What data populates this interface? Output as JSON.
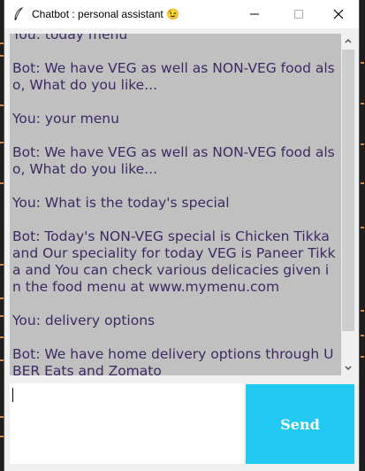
{
  "window": {
    "title": "Chatbot : personal assistant 😉"
  },
  "chat": {
    "messages": [
      "You: today menu",
      "Bot: We have VEG as well as NON-VEG food also, What do you like...",
      "You: your menu",
      "Bot: We have VEG as well as NON-VEG food also, What do you like...",
      "You: What is the today's special",
      "Bot: Today's NON-VEG special is Chicken Tikka and Our speciality for today VEG is Paneer Tikka and You can check various delicacies given in the food menu at www.mymenu.com",
      "You: delivery options",
      "Bot: We have home delivery options through UBER Eats and Zomato"
    ]
  },
  "input": {
    "value": ""
  },
  "send": {
    "label": "Send"
  },
  "colors": {
    "chat_bg": "#c0c0c0",
    "chat_text": "#3d2a63",
    "send_bg": "#22c9f3",
    "send_text": "#ffffff"
  }
}
